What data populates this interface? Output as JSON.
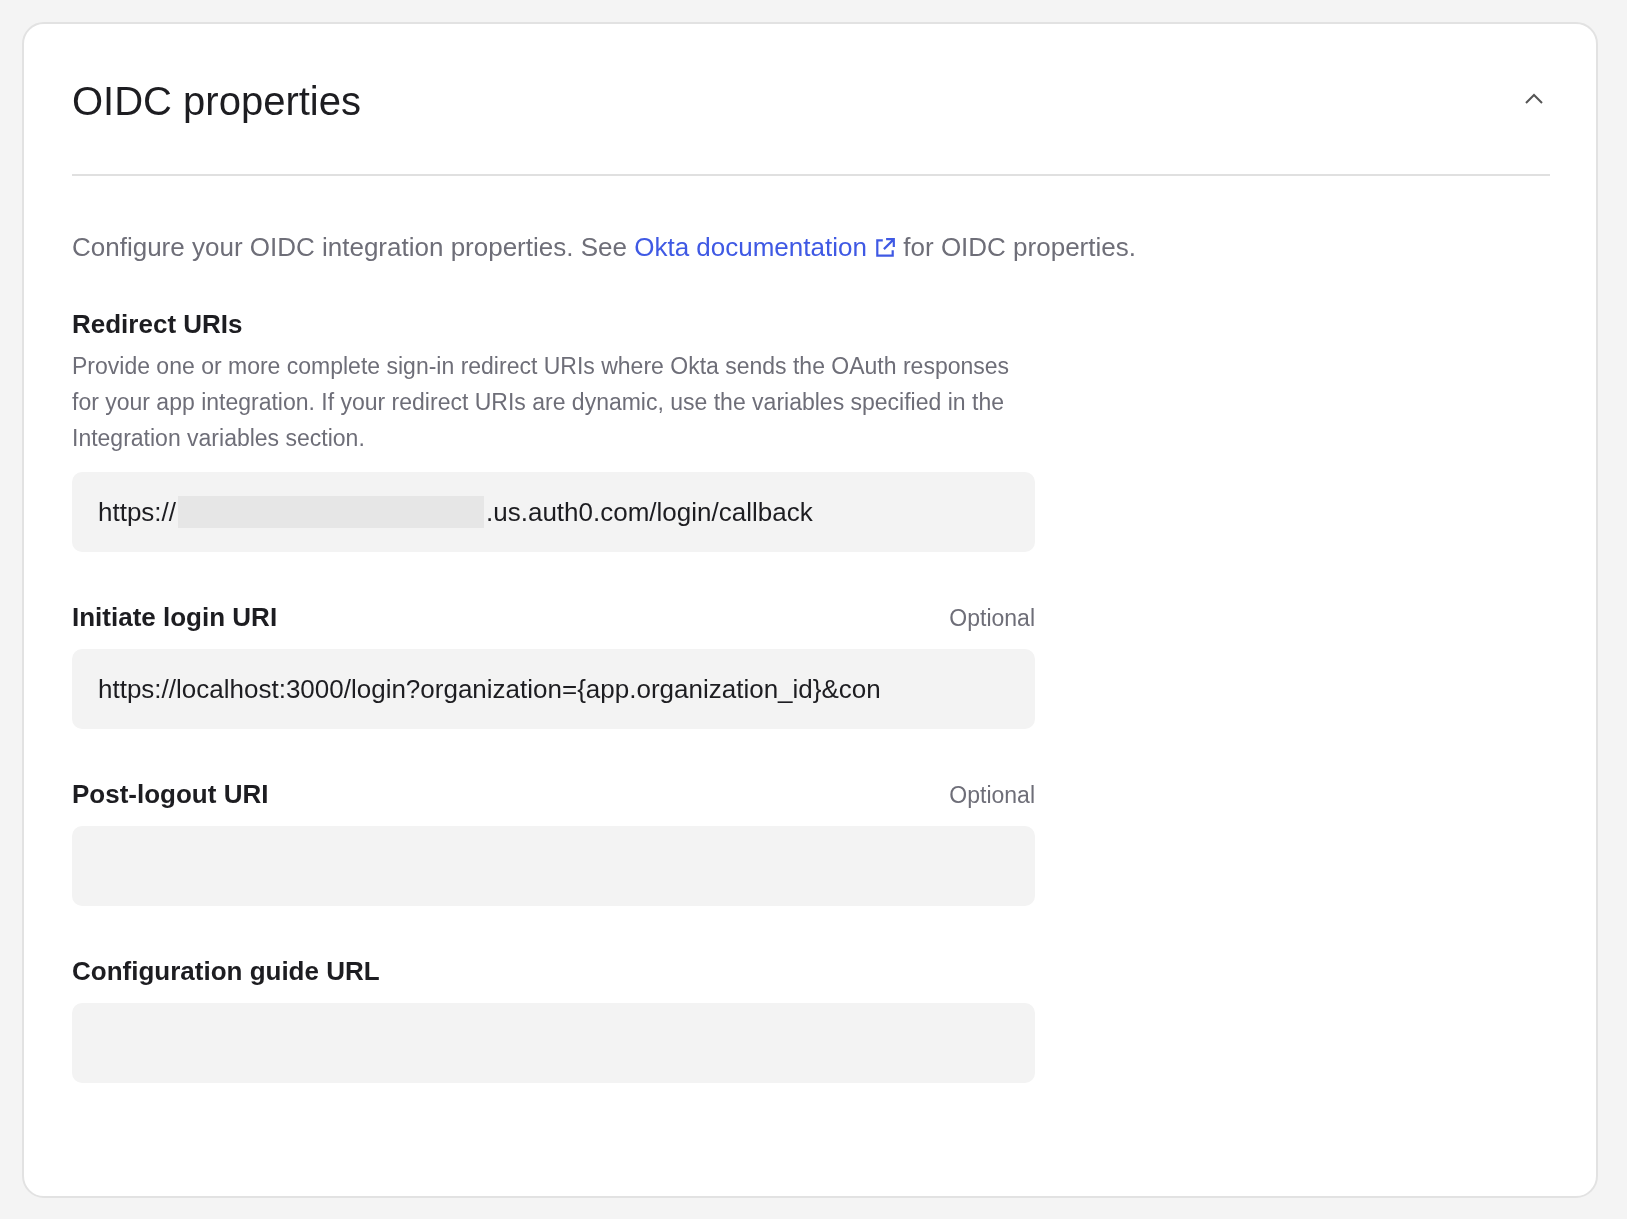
{
  "panel": {
    "title": "OIDC properties",
    "expanded": true,
    "description": {
      "before": "Configure your OIDC integration properties. See ",
      "link": "Okta documentation",
      "after": " for OIDC properties."
    }
  },
  "fields": [
    {
      "label": "Redirect URIs",
      "help": "Provide one or more complete sign-in redirect URIs where Okta sends the OAuth responses for your app integration. If your redirect URIs are dynamic, use the variables specified in the Integration variables section.",
      "value_start": "https://",
      "value_end": ".us.auth0.com/login/callback",
      "redacted": true
    },
    {
      "label": "Initiate login URI",
      "optional": "Optional",
      "value": "https://localhost:3000/login?organization={app.organization_id}&con"
    },
    {
      "label": "Post-logout URI",
      "optional": "Optional"
    },
    {
      "label": "Configuration guide URL"
    }
  ]
}
